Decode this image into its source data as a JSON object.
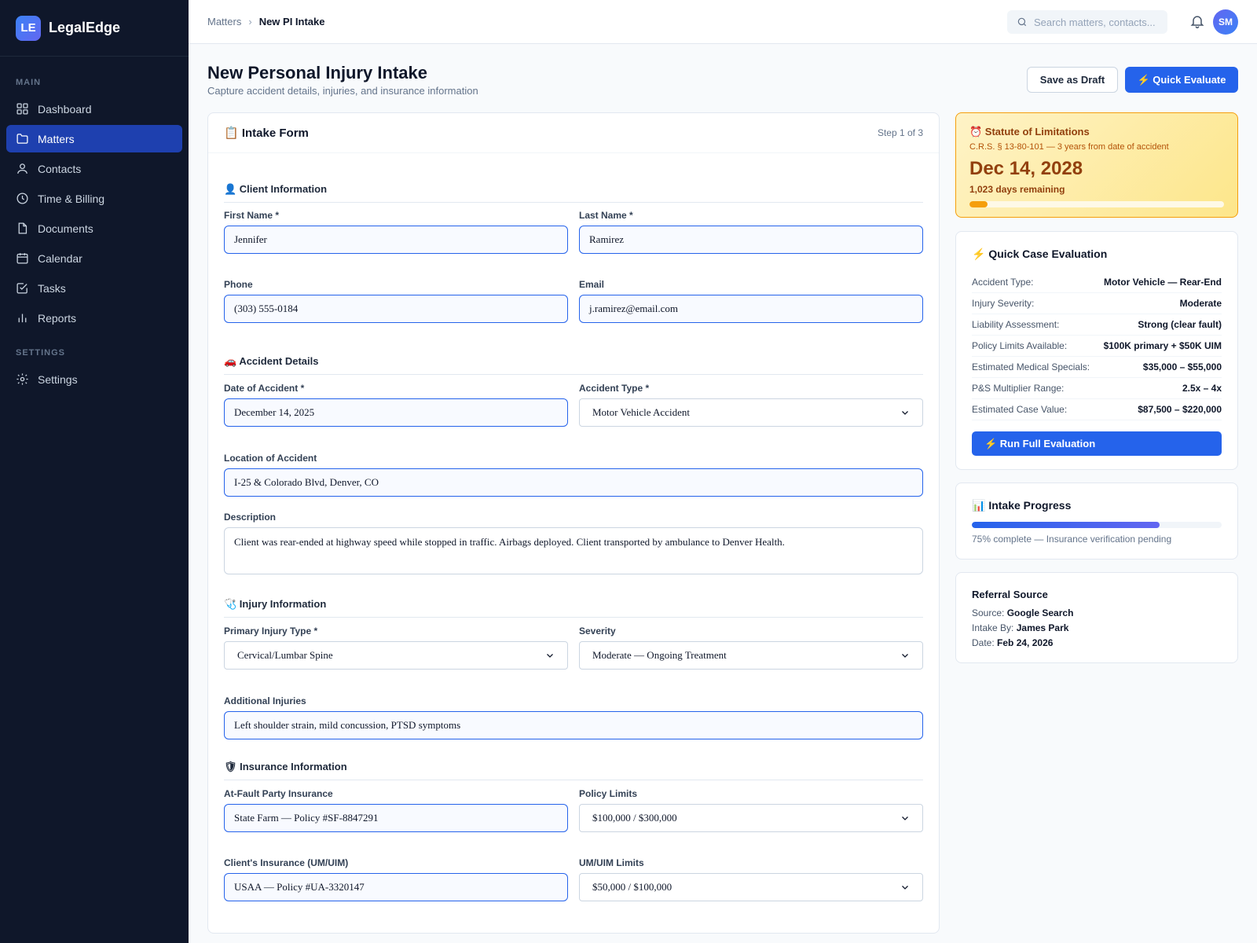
{
  "brand": {
    "logo": "LE",
    "name": "LegalEdge"
  },
  "nav": {
    "main_label": "MAIN",
    "settings_label": "SETTINGS",
    "items": [
      {
        "label": "Dashboard",
        "icon": "grid-icon"
      },
      {
        "label": "Matters",
        "icon": "folder-icon"
      },
      {
        "label": "Contacts",
        "icon": "user-icon"
      },
      {
        "label": "Time & Billing",
        "icon": "clock-icon"
      },
      {
        "label": "Documents",
        "icon": "document-icon"
      },
      {
        "label": "Calendar",
        "icon": "calendar-icon"
      },
      {
        "label": "Tasks",
        "icon": "checkbox-icon"
      },
      {
        "label": "Reports",
        "icon": "bar-chart-icon"
      }
    ],
    "settings_item": "Settings",
    "active": "Matters"
  },
  "topbar": {
    "breadcrumb_parent": "Matters",
    "breadcrumb_current": "New PI Intake",
    "search_placeholder": "Search matters, contacts...",
    "avatar_initials": "SM"
  },
  "page": {
    "title": "New Personal Injury Intake",
    "subtitle": "Capture accident details, injuries, and insurance information",
    "save_draft_label": "Save as Draft",
    "quick_evaluate_label": "⚡ Quick Evaluate"
  },
  "form": {
    "title": "📋 Intake Form",
    "step": "Step 1 of 3",
    "client_section": "👤 Client Information",
    "first_name_label": "First Name *",
    "first_name": "Jennifer",
    "last_name_label": "Last Name *",
    "last_name": "Ramirez",
    "phone_label": "Phone",
    "phone": "(303) 555-0184",
    "email_label": "Email",
    "email": "j.ramirez@email.com",
    "accident_section": "🚗 Accident Details",
    "date_label": "Date of Accident *",
    "date": "December 14, 2025",
    "type_label": "Accident Type *",
    "type": "Motor Vehicle Accident",
    "location_label": "Location of Accident",
    "location": "I-25 & Colorado Blvd, Denver, CO",
    "description_label": "Description",
    "description": "Client was rear-ended at highway speed while stopped in traffic. Airbags deployed. Client transported by ambulance to Denver Health.",
    "injury_section": "🩺 Injury Information",
    "primary_injury_label": "Primary Injury Type *",
    "primary_injury": "Cervical/Lumbar Spine",
    "severity_label": "Severity",
    "severity": "Moderate — Ongoing Treatment",
    "additional_label": "Additional Injuries",
    "additional": "Left shoulder strain, mild concussion, PTSD symptoms",
    "insurance_section": "🛡 Insurance Information",
    "atfault_label": "At-Fault Party Insurance",
    "atfault": "State Farm — Policy #SF-8847291",
    "policy_limits_label": "Policy Limits",
    "policy_limits": "$100,000 / $300,000",
    "client_ins_label": "Client's Insurance (UM/UIM)",
    "client_ins": "USAA — Policy #UA-3320147",
    "uim_label": "UM/UIM Limits",
    "uim": "$50,000 / $100,000"
  },
  "sol": {
    "title": "⏰ Statute of Limitations",
    "sub": "C.R.S. § 13-80-101 — 3 years from date of accident",
    "date": "Dec 14, 2028",
    "days": "1,023 days remaining",
    "elapsed_percent": 7
  },
  "evaluation": {
    "title": "⚡ Quick Case Evaluation",
    "rows": [
      {
        "k": "Accident Type:",
        "v": "Motor Vehicle — Rear-End"
      },
      {
        "k": "Injury Severity:",
        "v": "Moderate"
      },
      {
        "k": "Liability Assessment:",
        "v": "Strong (clear fault)"
      },
      {
        "k": "Policy Limits Available:",
        "v": "$100K primary + $50K UIM"
      },
      {
        "k": "Estimated Medical Specials:",
        "v": "$35,000 – $55,000"
      },
      {
        "k": "P&S Multiplier Range:",
        "v": "2.5x – 4x"
      },
      {
        "k": "Estimated Case Value:",
        "v": "$87,500 – $220,000"
      }
    ],
    "run_label": "⚡ Run Full Evaluation"
  },
  "progress": {
    "title": "📊 Intake Progress",
    "percent": 75,
    "text": "75% complete — Insurance verification pending"
  },
  "referral": {
    "title": "Referral Source",
    "source_label": "Source:",
    "source": "Google Search",
    "intake_label": "Intake By:",
    "intake": "James Park",
    "date_label": "Date:",
    "date": "Feb 24, 2026"
  },
  "colors": {
    "accent": "#2563eb",
    "sidebar": "#0f172a",
    "warning": "#f59e0b"
  }
}
